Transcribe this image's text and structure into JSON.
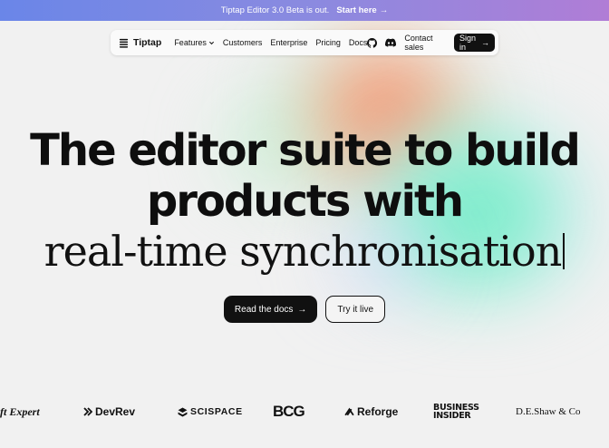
{
  "announcement": {
    "text": "Tiptap Editor 3.0 Beta is out.",
    "cta": "Start here"
  },
  "nav": {
    "brand": "Tiptap",
    "links": [
      "Features",
      "Customers",
      "Enterprise",
      "Pricing",
      "Docs"
    ],
    "contact": "Contact sales",
    "signin": "Sign in"
  },
  "hero": {
    "line1": "The editor suite to build",
    "line2": "products with",
    "line3": "real-time synchronisation"
  },
  "buttons": {
    "primary": "Read the docs",
    "secondary": "Try it live"
  },
  "logos": [
    "oft Expert",
    "DevRev",
    "SCISPACE",
    "BCG",
    "Reforge",
    "BUSINESS INSIDER",
    "D.E.Shaw & Co"
  ],
  "logo_parts": {
    "bi_top": "BUSINESS",
    "bi_bottom": "INSIDER"
  },
  "colors": {
    "accent_dark": "#111111",
    "announce_start": "#6a86e8",
    "announce_end": "#b07dd6"
  }
}
